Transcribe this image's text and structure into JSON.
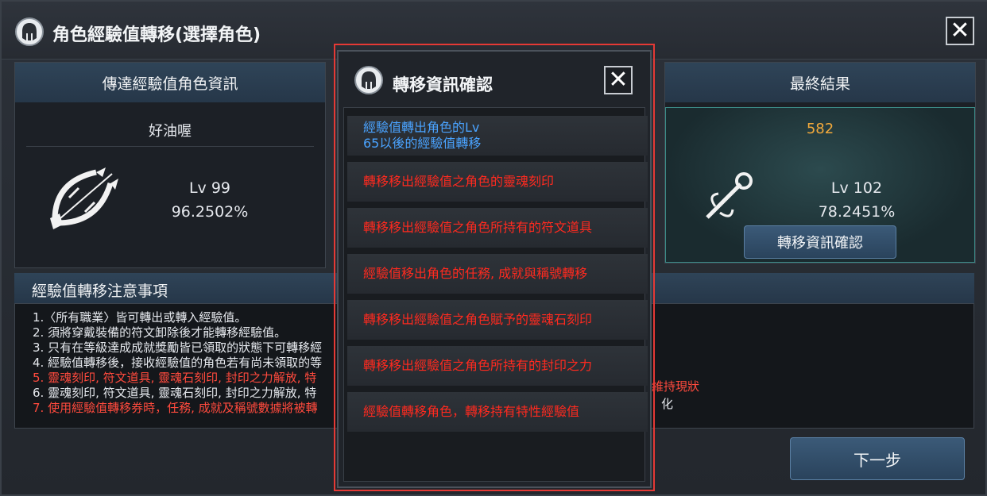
{
  "window": {
    "title": "角色經驗值轉移(選擇角色)"
  },
  "left_panel": {
    "header": "傳達經驗值角色資訊",
    "character_name": "好油喔",
    "level": "Lv 99",
    "percent": "96.2502%",
    "class_icon": "bow-icon"
  },
  "right_panel": {
    "header": "最終結果",
    "value": "582",
    "level": "Lv 102",
    "percent": "78.2451%",
    "class_icon": "mace-icon",
    "confirm_button": "轉移資訊確認"
  },
  "notes": {
    "header": "經驗值轉移注意事項",
    "lines": [
      {
        "text": "1.〈所有職業〉皆可轉出或轉入經驗值。",
        "red": false
      },
      {
        "text": "2. 須將穿戴裝備的符文卸除後才能轉移經驗值。",
        "red": false
      },
      {
        "text": "3. 只有在等級達成成就獎勵皆已領取的狀態下可轉移經",
        "red": false
      },
      {
        "text": "4. 經驗值轉移後，接收經驗值的角色若有尚未領取的等",
        "red": false
      },
      {
        "text": "5. 靈魂刻印, 符文道具, 靈魂石刻印, 封印之力解放, 特",
        "red": true
      },
      {
        "text": "6. 靈魂刻印, 符文道具, 靈魂石刻印, 封印之力解放, 特",
        "red": false
      },
      {
        "text": "7. 使用經驗值轉移券時，任務, 成就及稱號數據將被轉",
        "red": true
      }
    ],
    "line5_tail": "維持現狀",
    "line6_tail": "化"
  },
  "next_button": "下一步",
  "modal": {
    "title": "轉移資訊確認",
    "rows": [
      {
        "line1": "經驗值轉出角色的Lv",
        "line2": "65以後的經驗值轉移",
        "color": "blue"
      },
      {
        "line1": "轉移移出經驗值之角色的靈魂刻印",
        "line2": "",
        "color": "red"
      },
      {
        "line1": "轉移移出經驗值之角色所持有的符文道具",
        "line2": "",
        "color": "red"
      },
      {
        "line1": "經驗值移出角色的任務, 成就與稱號轉移",
        "line2": "",
        "color": "red"
      },
      {
        "line1": "轉移移出經驗值之角色賦予的靈魂石刻印",
        "line2": "",
        "color": "red"
      },
      {
        "line1": "轉移移出經驗值之角色所持有的封印之力",
        "line2": "",
        "color": "red"
      },
      {
        "line1": "經驗值轉移角色，轉移持有特性經驗值",
        "line2": "",
        "color": "red"
      }
    ]
  }
}
